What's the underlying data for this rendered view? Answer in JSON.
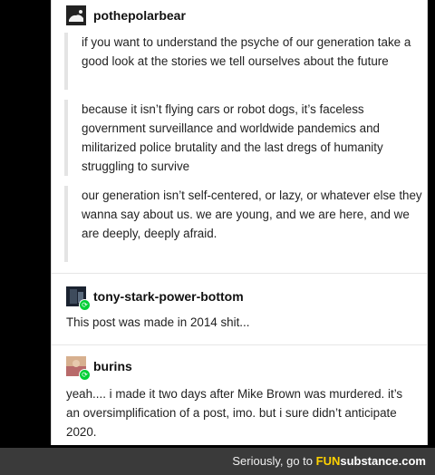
{
  "posts": [
    {
      "username": "pothepolarbear",
      "paragraphs": [
        "if you want to understand the psyche of our generation take a good look at the stories we tell ourselves about the future",
        "because it isn’t flying cars or robot dogs, it’s faceless government surveillance and worldwide pandemics and militarized police brutality and the last dregs of humanity struggling to survive",
        "our generation isn’t self-centered, or lazy, or whatever else they wanna say about us. we are young, and we are here, and we are deeply, deeply afraid."
      ]
    },
    {
      "username": "tony-stark-power-bottom",
      "text": "This post was made in 2014 shit..."
    },
    {
      "username": "burins",
      "text": "yeah.... i made it two days after Mike Brown was murdered. it’s an oversimplification of a post, imo. but i sure didn’t anticipate 2020."
    }
  ],
  "footer": {
    "prefix": "Seriously, go to ",
    "brand_highlight": "FUN",
    "brand_rest": "substance.com"
  },
  "icons": {
    "reblog": "reblog-icon"
  },
  "colors": {
    "reblog_badge": "#00cf35",
    "brand_fun": "#ffd200"
  }
}
